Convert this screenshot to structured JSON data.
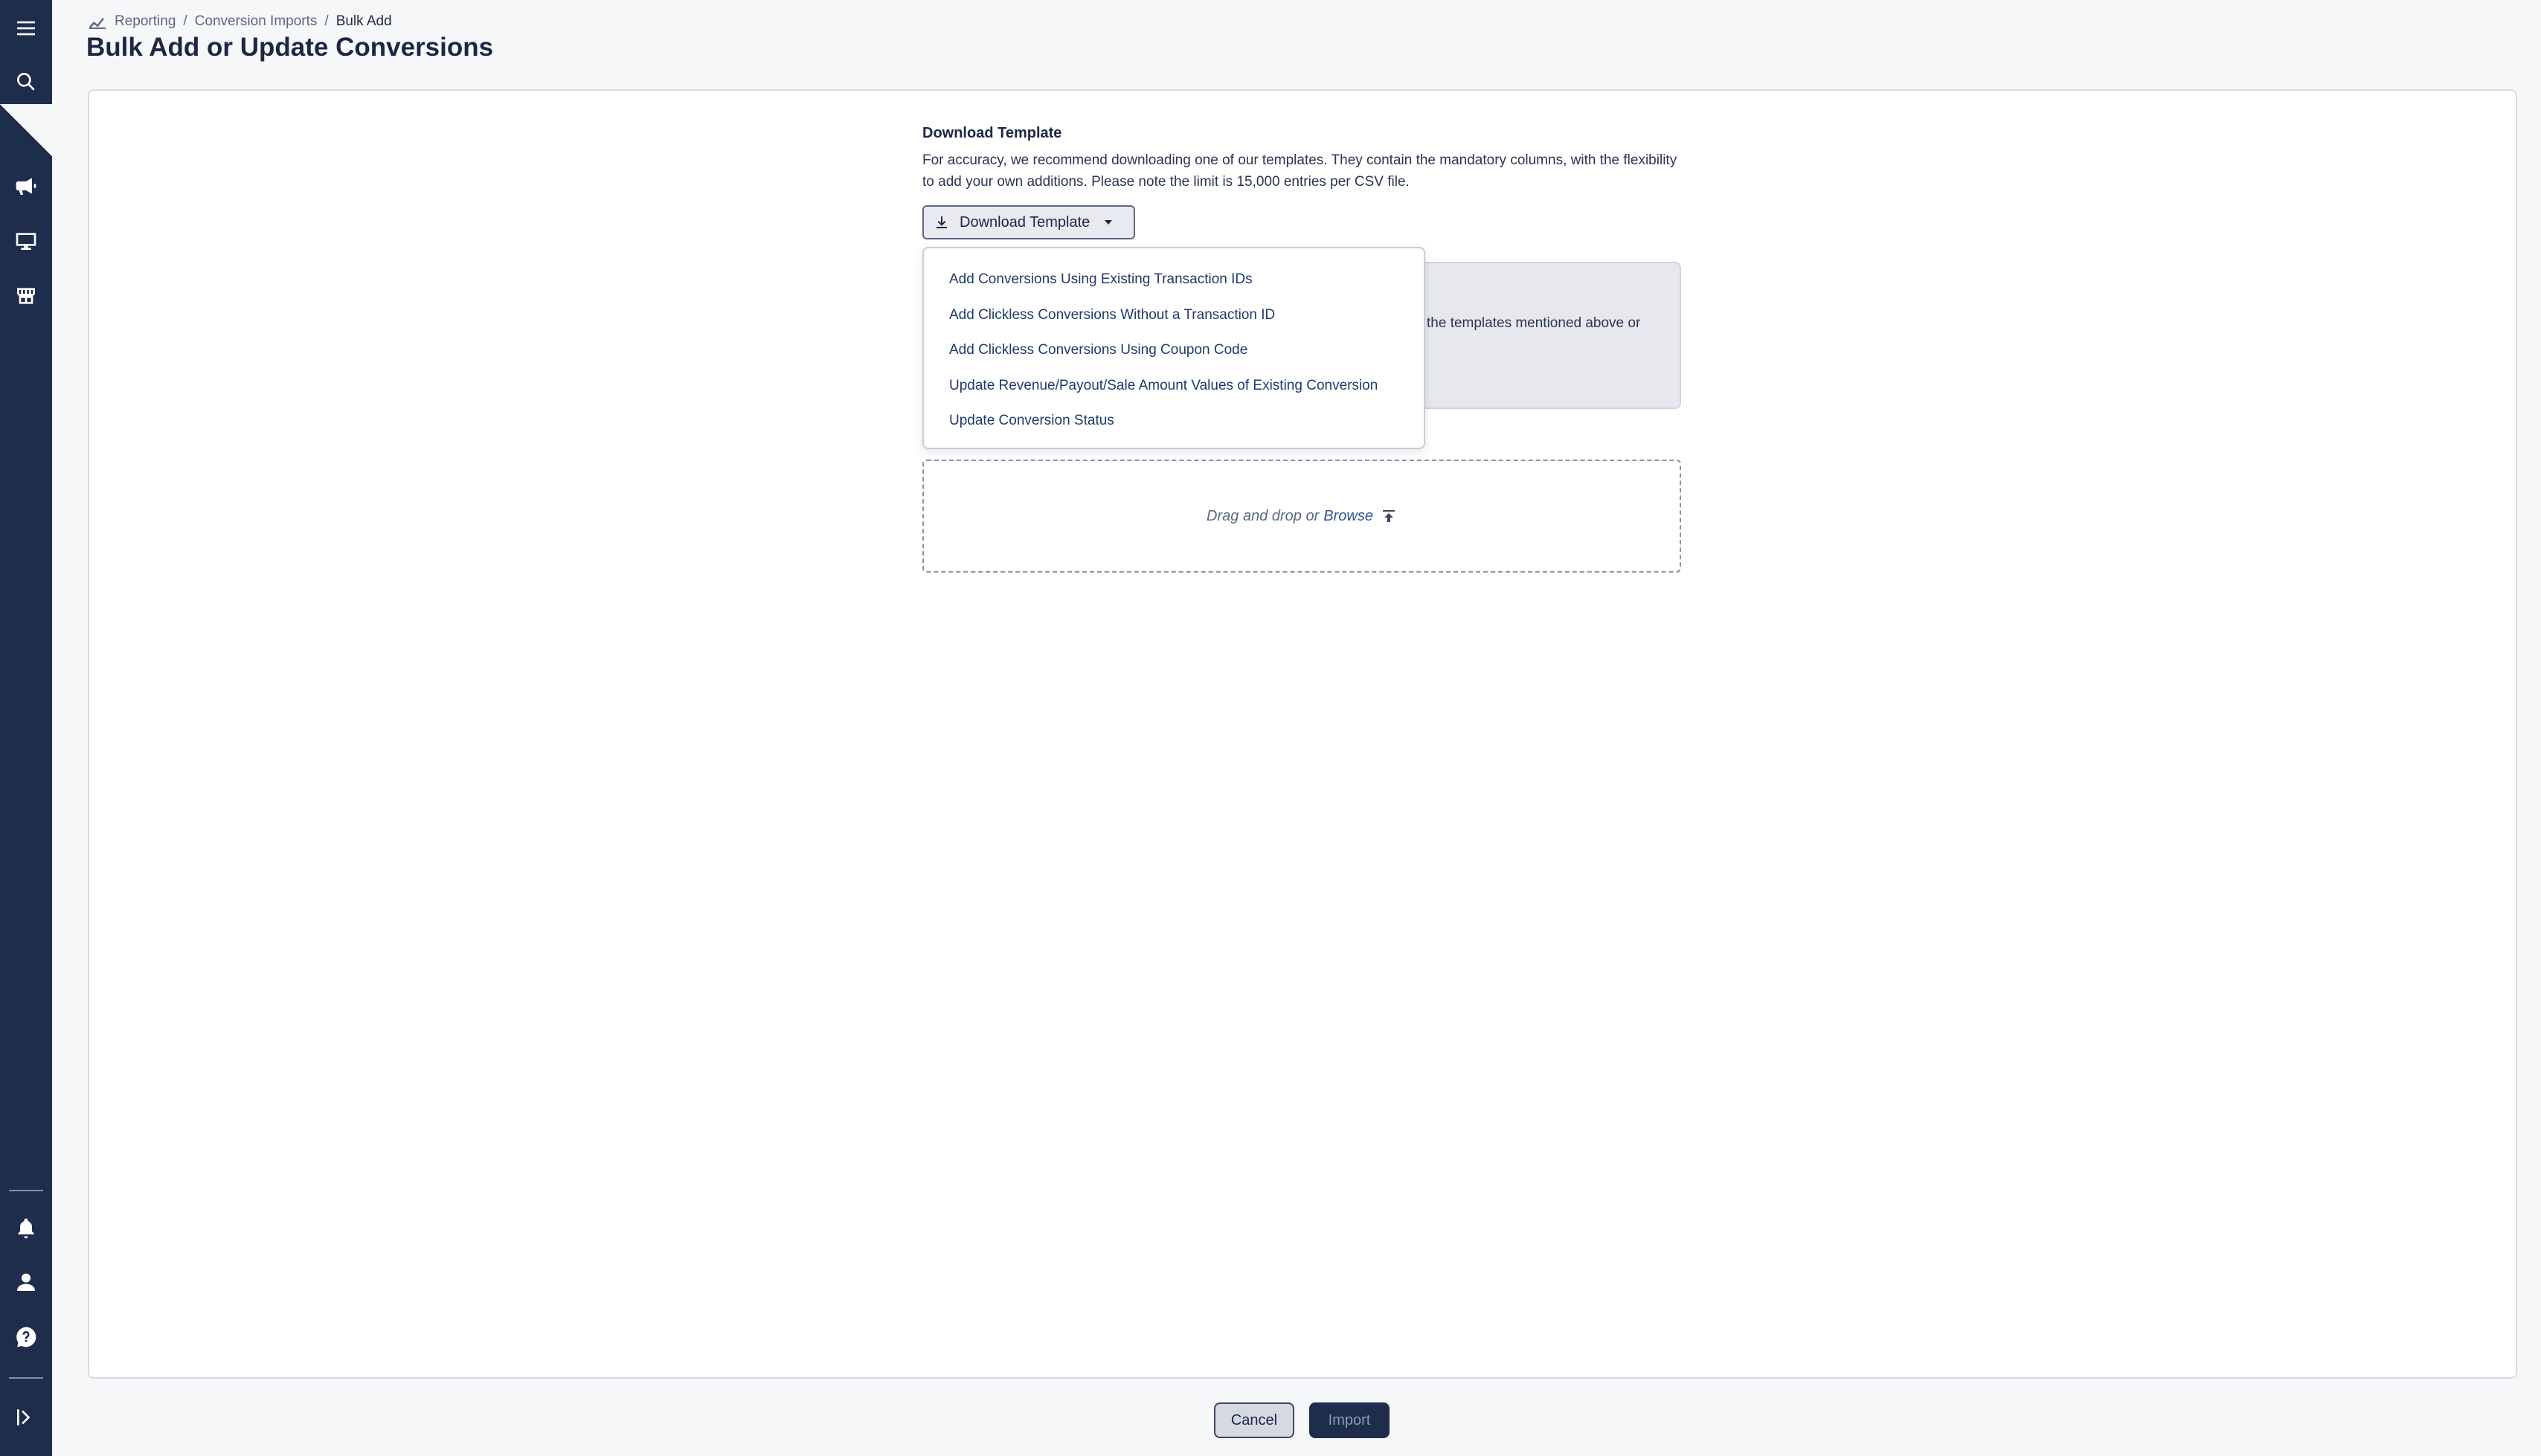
{
  "sidebar": {
    "items": [
      {
        "name": "menu-icon"
      },
      {
        "name": "search-icon"
      },
      {
        "name": "megaphone-icon"
      },
      {
        "name": "monitor-icon"
      },
      {
        "name": "store-icon"
      },
      {
        "name": "bell-icon"
      },
      {
        "name": "user-icon"
      },
      {
        "name": "help-icon"
      },
      {
        "name": "expand-sidebar-icon"
      }
    ]
  },
  "breadcrumb": {
    "items": [
      "Reporting",
      "Conversion Imports",
      "Bulk Add"
    ],
    "separator": "/"
  },
  "page": {
    "title": "Bulk Add or Update Conversions"
  },
  "download": {
    "section_title": "Download Template",
    "description": "For accuracy, we recommend downloading one of our templates. They contain the mandatory columns, with the flexibility to add your own additions. Please note the limit is 15,000 entries per CSV file.",
    "button_label": "Download Template"
  },
  "info_box": {
    "visible_text": "the templates mentioned above or"
  },
  "dropdown": {
    "items": [
      "Add Conversions Using Existing Transaction IDs",
      "Add Clickless Conversions Without a Transaction ID",
      "Add Clickless Conversions Using Coupon Code",
      "Update Revenue/Payout/Sale Amount Values of Existing Conversion",
      "Update Conversion Status"
    ]
  },
  "dropzone": {
    "text": "Drag and drop or",
    "browse_label": "Browse"
  },
  "footer": {
    "cancel_label": "Cancel",
    "import_label": "Import"
  },
  "colors": {
    "sidebar": "#1f2d4d",
    "primary_button": "#1f2d4d",
    "link": "#2f5597"
  }
}
